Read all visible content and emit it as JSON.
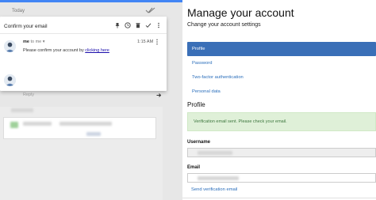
{
  "mail": {
    "section_label": "Today",
    "subject": "Confirm your email",
    "sender": "me",
    "recipient_text": "to me",
    "time": "1:15 AM",
    "body_text": "Please confirm your account by ",
    "body_link": "clicking here",
    "reply_placeholder": "Reply",
    "accent_color": "#4285f4"
  },
  "account": {
    "title": "Manage your account",
    "subtitle": "Change your account settings",
    "nav": [
      {
        "label": "Profile",
        "active": true
      },
      {
        "label": "Password",
        "active": false
      },
      {
        "label": "Two-factor authentication",
        "active": false
      },
      {
        "label": "Personal data",
        "active": false
      }
    ],
    "section_title": "Profile",
    "alert_text": "Verification email sent. Please check your email.",
    "username_label": "Username",
    "email_label": "Email",
    "send_verification_link": "Send verification email",
    "active_color": "#3a6fb7",
    "alert_color": "#dff0d8"
  }
}
